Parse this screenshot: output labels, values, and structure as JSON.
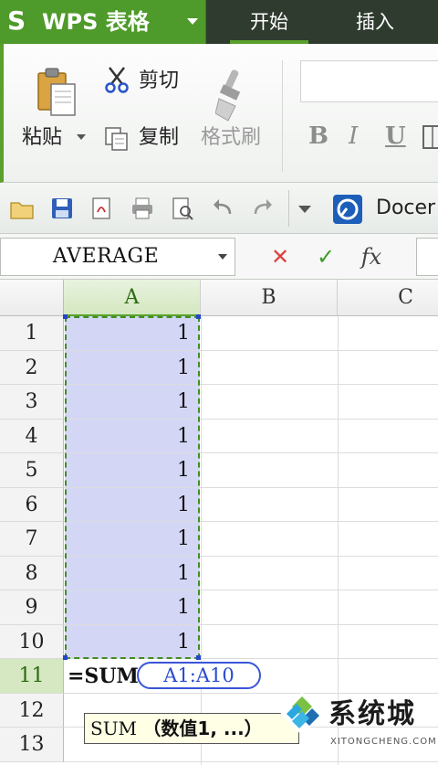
{
  "app": {
    "logo": "S",
    "title": "WPS 表格"
  },
  "tabs": [
    {
      "label": "开始"
    },
    {
      "label": "插入"
    }
  ],
  "ribbon": {
    "paste_label": "粘贴",
    "cut_label": "剪切",
    "copy_label": "复制",
    "format_painter_label": "格式刷",
    "bold_label": "B",
    "italic_label": "I",
    "underline_label": "U"
  },
  "qat": {
    "docer_label": "Docer"
  },
  "formula_bar": {
    "name_box": "AVERAGE",
    "cancel_glyph": "✕",
    "enter_glyph": "✓",
    "fx_label": "fx"
  },
  "sheet": {
    "columns": [
      "A",
      "B",
      "C"
    ],
    "active_column": "A",
    "rows": [
      {
        "num": "1",
        "a": "1"
      },
      {
        "num": "2",
        "a": "1"
      },
      {
        "num": "3",
        "a": "1"
      },
      {
        "num": "4",
        "a": "1"
      },
      {
        "num": "5",
        "a": "1"
      },
      {
        "num": "6",
        "a": "1"
      },
      {
        "num": "7",
        "a": "1"
      },
      {
        "num": "8",
        "a": "1"
      },
      {
        "num": "9",
        "a": "1"
      },
      {
        "num": "10",
        "a": "1"
      },
      {
        "num": "11",
        "a": ""
      },
      {
        "num": "12",
        "a": ""
      },
      {
        "num": "13",
        "a": ""
      }
    ],
    "active_row": "11",
    "edit_formula_prefix": "=SUM",
    "edit_formula_ref": "A1:A10",
    "tooltip_func": "SUM",
    "tooltip_args": "（数值1, ...）"
  },
  "watermark": {
    "text": "系统城",
    "sub": "XITONGCHENG.COM"
  },
  "colors": {
    "accent_green": "#5aa02c",
    "selection_fill": "#d4d6f6",
    "reference_blue": "#3a56d8",
    "cancel_red": "#e04040",
    "enter_green": "#3d9a2a"
  }
}
